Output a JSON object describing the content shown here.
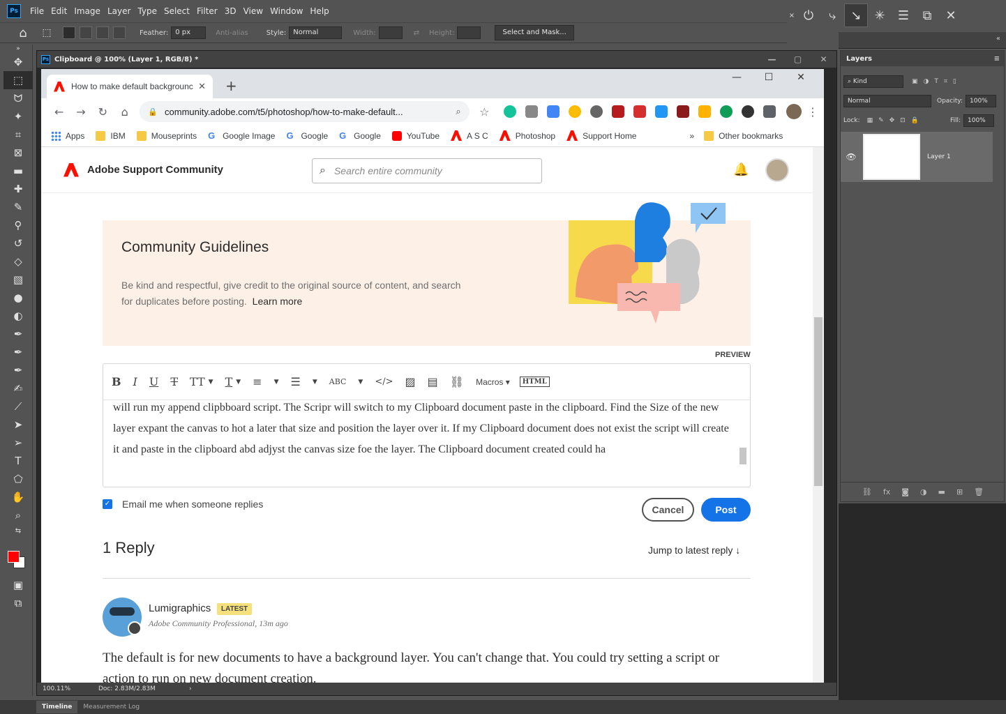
{
  "ps": {
    "menu": [
      "File",
      "Edit",
      "Image",
      "Layer",
      "Type",
      "Select",
      "Filter",
      "3D",
      "View",
      "Window",
      "Help"
    ],
    "options": {
      "feather_label": "Feather:",
      "feather_value": "0 px",
      "antialias_label": "Anti-alias",
      "style_label": "Style:",
      "style_value": "Normal",
      "width_label": "Width:",
      "height_label": "Height:",
      "select_mask_label": "Select and Mask..."
    },
    "document": {
      "title": "Clipboard @ 100% (Layer 1, RGB/8) *",
      "zoom": "100.11%",
      "doc_size": "Doc: 2.83M/2.83M"
    },
    "layers_panel": {
      "tab": "Layers",
      "filter": "Kind",
      "blend_mode": "Normal",
      "opacity_label": "Opacity:",
      "opacity_value": "100%",
      "lock_label": "Lock:",
      "fill_label": "Fill:",
      "fill_value": "100%",
      "layer_name": "Layer 1"
    },
    "bottom_tabs": [
      "Timeline",
      "Measurement Log"
    ],
    "colors": {
      "foreground": "#ff0000",
      "background": "#ffffff"
    }
  },
  "browser": {
    "tab_title": "How to make default backgrounc",
    "url": "community.adobe.com/t5/photoshop/how-to-make-default...",
    "bookmarks": [
      "Apps",
      "IBM",
      "Mouseprints",
      "Google Image",
      "Google",
      "Google",
      "YouTube",
      "A S C",
      "Photoshop",
      "Support Home"
    ],
    "other_bookmarks": "Other bookmarks",
    "more": "»"
  },
  "page": {
    "site_title": "Adobe Support Community",
    "search_placeholder": "Search entire community",
    "guidelines": {
      "title": "Community Guidelines",
      "body": "Be kind and respectful, give credit to the original source of content, and search for duplicates before posting.",
      "link": "Learn more"
    },
    "preview_label": "PREVIEW",
    "editor": {
      "macros": "Macros",
      "html": "HTML",
      "text": "will run my append clipbboard  script.  The Scripr will switch to my Clipboard document paste in the clipboard.  Find the Size of the new layer expant the canvas to hot a later that size and position the layer over it.  If my Clipboard document does not exist the script will create it and paste in the clipboard abd adjyst the canvas size foe the layer.  The Clipboard document created could ha"
    },
    "email_label": "Email me when someone replies",
    "cancel_label": "Cancel",
    "post_label": "Post",
    "reply_count": "1 Reply",
    "jump_label": "Jump to latest reply",
    "reply": {
      "author": "Lumigraphics",
      "badge": "LATEST",
      "meta": "Adobe Community Professional, 13m ago",
      "body": "The default is for new documents to have a background layer. You can't change that. You could try setting a script or action to run on new document creation."
    }
  }
}
